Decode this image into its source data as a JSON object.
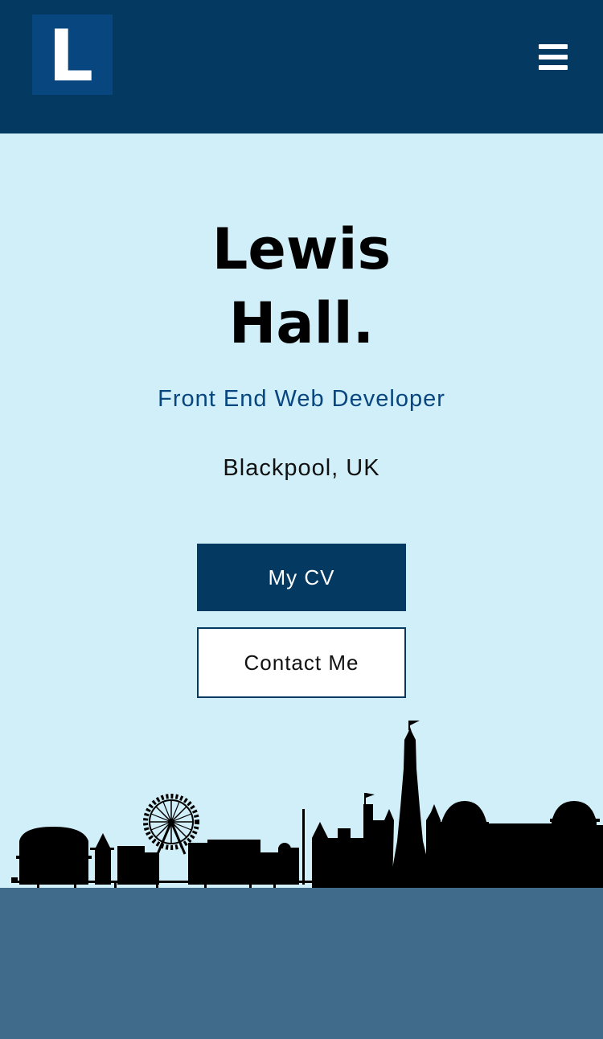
{
  "header": {
    "logo_letter": "L",
    "menu_icon": "hamburger-menu-icon"
  },
  "hero": {
    "name_line1": "Lewis",
    "name_line2": "Hall.",
    "role": "Front End Web Developer",
    "location": "Blackpool, UK",
    "cv_button": "My CV",
    "contact_button": "Contact Me"
  },
  "colors": {
    "header_bg": "#043961",
    "logo_bg": "#07467f",
    "hero_bg": "#d1eff9",
    "accent_text": "#07467f",
    "footer_bg": "#416b8b"
  }
}
